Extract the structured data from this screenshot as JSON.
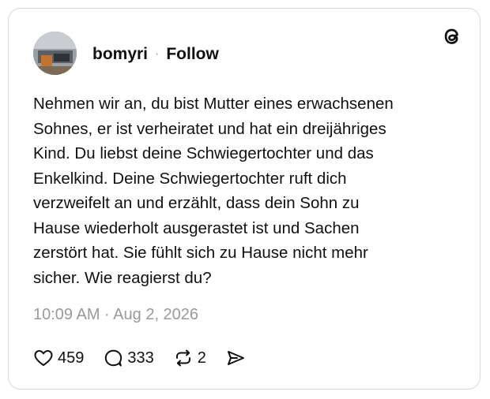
{
  "post": {
    "username": "bomyri",
    "separator": "·",
    "follow_label": "Follow",
    "body": "Nehmen wir an, du bist Mutter eines erwachsenen\nSohnes, er ist verheiratet und hat ein dreijähriges\nKind. Du liebst deine Schwiegertochter und das\nEnkelkind. Deine Schwiegertochter ruft dich\nverzweifelt an und erzählt, dass dein Sohn zu\nHause wiederholt ausgerastet ist und Sachen\nzerstört hat. Sie fühlt sich zu Hause nicht mehr\nsicher. Wie reagierst du?",
    "timestamp": "10:09 AM · Aug 2, 2026"
  },
  "actions": {
    "likes": "459",
    "replies": "333",
    "reposts": "2"
  },
  "icons": {
    "logo": "threads-logo-icon",
    "like": "heart-icon",
    "reply": "speech-bubble-icon",
    "repost": "repost-arrows-icon",
    "share": "send-icon"
  },
  "colors": {
    "text": "#101010",
    "muted": "#9a9a9a",
    "border": "#d9d9d9"
  }
}
